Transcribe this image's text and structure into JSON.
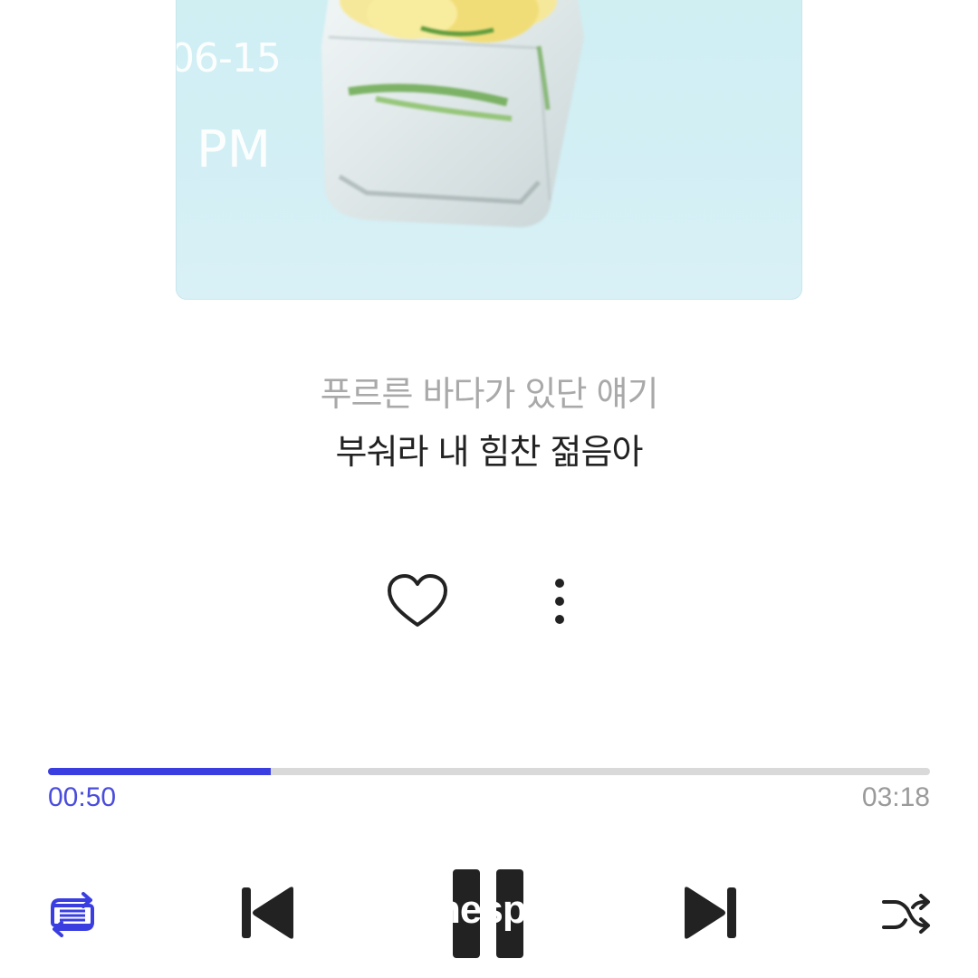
{
  "album": {
    "overlay_date": "06-15",
    "overlay_ampm": "PM"
  },
  "lyrics": {
    "previous_line": "푸르른 바다가 있단 얘기",
    "current_line": "부숴라 내 힘찬 젊음아"
  },
  "actions": {
    "like_icon": "heart-outline-icon",
    "more_icon": "more-vertical-icon"
  },
  "playback": {
    "elapsed": "00:50",
    "total": "03:18",
    "progress_fraction": 0.2525
  },
  "controls": {
    "repeat_icon": "repeat-list-icon",
    "previous_icon": "skip-previous-icon",
    "play_pause_icon": "pause-icon",
    "play_overlay_text": "nespr",
    "next_icon": "skip-next-icon",
    "shuffle_icon": "shuffle-icon"
  },
  "colors": {
    "accent": "#3a3ee0",
    "control_dark": "#222222",
    "track": "#d9d9d9",
    "muted_text": "#a9a9a9"
  }
}
